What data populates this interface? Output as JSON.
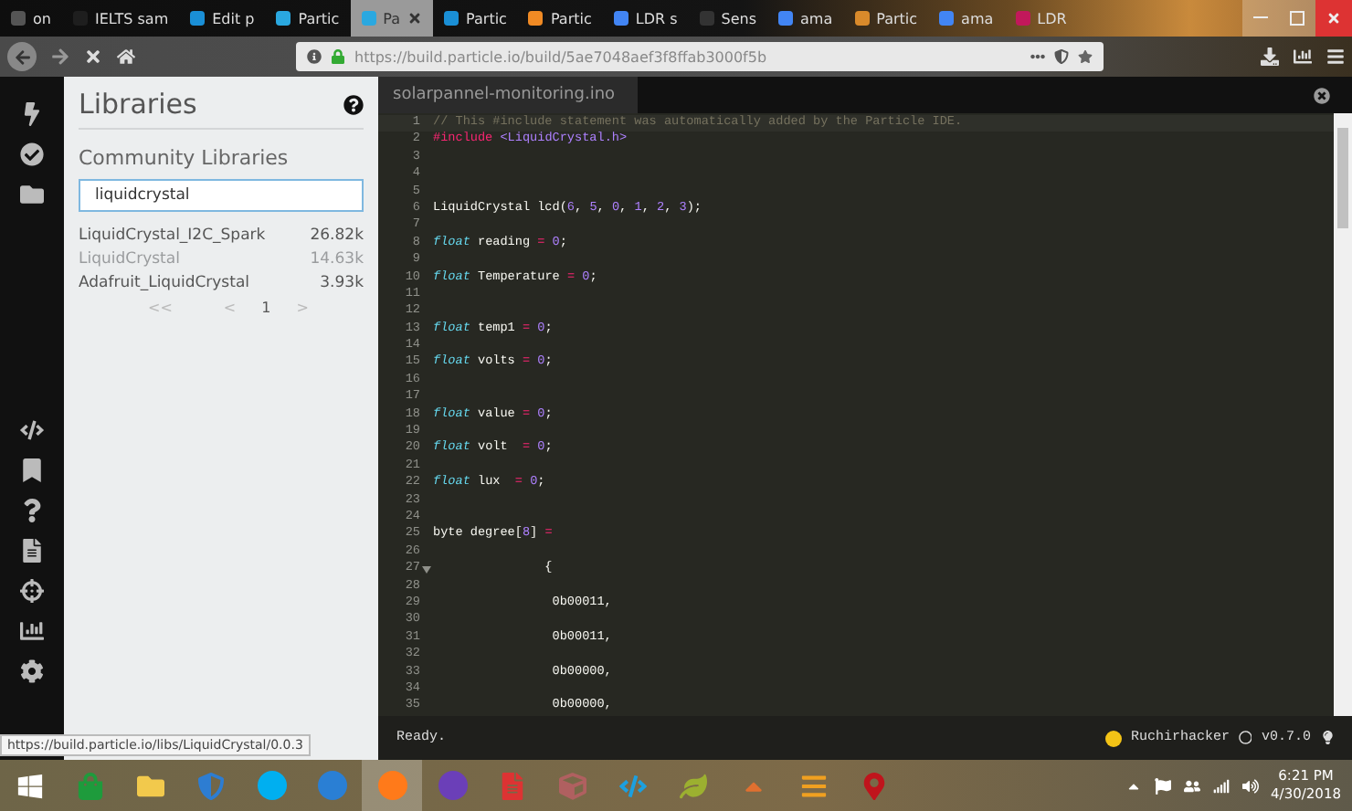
{
  "browser": {
    "tabs": [
      {
        "label": "on",
        "color": "#555555",
        "selected": false
      },
      {
        "label": "IELTS sam",
        "color": "#1e1e1e",
        "selected": false
      },
      {
        "label": "Edit p",
        "color": "#1a8fd6",
        "selected": false
      },
      {
        "label": "Partic",
        "color": "#2aa8e0",
        "selected": false
      },
      {
        "label": "Pa",
        "color": "#2aa8e0",
        "selected": true
      },
      {
        "label": "Partic",
        "color": "#1a8fd6",
        "selected": false
      },
      {
        "label": "Partic",
        "color": "#f08a24",
        "selected": false
      },
      {
        "label": "LDR s",
        "color": "#4285f4",
        "selected": false
      },
      {
        "label": "Sens",
        "color": "#333333",
        "selected": false
      },
      {
        "label": "ama",
        "color": "#4285f4",
        "selected": false
      },
      {
        "label": "Partic",
        "color": "#d98a2b",
        "selected": false
      },
      {
        "label": "ama",
        "color": "#4285f4",
        "selected": false
      },
      {
        "label": "LDR",
        "color": "#c2185b",
        "selected": false
      }
    ],
    "url": "https://build.particle.io/build/5ae7048aef3f8ffab3000f5b"
  },
  "libraries": {
    "title": "Libraries",
    "section": "Community Libraries",
    "search": {
      "value": "liquidcrystal"
    },
    "results": [
      {
        "name": "LiquidCrystal_I2C_Spark",
        "count": "26.82k",
        "disabled": false
      },
      {
        "name": "LiquidCrystal",
        "count": "14.63k",
        "disabled": true
      },
      {
        "name": "Adafruit_LiquidCrystal",
        "count": "3.93k",
        "disabled": false
      }
    ],
    "pager": {
      "first": "<<",
      "prev": "<",
      "page": "1",
      "next": ">"
    }
  },
  "editor": {
    "file_tab": "solarpannel-monitoring.ino",
    "lines": [
      {
        "n": "1",
        "fold": false,
        "tokens": [
          {
            "kind": "comment",
            "s": "// This #include statement was automatically added by the Particle IDE."
          }
        ]
      },
      {
        "n": "2",
        "fold": false,
        "tokens": [
          {
            "kind": "directive",
            "s": "#include "
          },
          {
            "kind": "path",
            "s": "<LiquidCrystal.h>"
          }
        ]
      },
      {
        "n": "3",
        "fold": false
      },
      {
        "n": "4",
        "fold": false
      },
      {
        "n": "5",
        "fold": false
      },
      {
        "n": "6",
        "fold": false,
        "tokens": [
          {
            "kind": "plain",
            "s": "LiquidCrystal lcd("
          },
          {
            "kind": "number",
            "s": "6"
          },
          {
            "kind": "plain",
            "s": ", "
          },
          {
            "kind": "number",
            "s": "5"
          },
          {
            "kind": "plain",
            "s": ", "
          },
          {
            "kind": "number",
            "s": "0"
          },
          {
            "kind": "plain",
            "s": ", "
          },
          {
            "kind": "number",
            "s": "1"
          },
          {
            "kind": "plain",
            "s": ", "
          },
          {
            "kind": "number",
            "s": "2"
          },
          {
            "kind": "plain",
            "s": ", "
          },
          {
            "kind": "number",
            "s": "3"
          },
          {
            "kind": "plain",
            "s": ");"
          }
        ]
      },
      {
        "n": "7",
        "fold": false
      },
      {
        "n": "8",
        "fold": false,
        "tokens": [
          {
            "kind": "keyword",
            "s": "float"
          },
          {
            "kind": "plain",
            "s": " reading "
          },
          {
            "kind": "operator",
            "s": "= "
          },
          {
            "kind": "number",
            "s": "0"
          },
          {
            "kind": "plain",
            "s": ";"
          }
        ]
      },
      {
        "n": "9",
        "fold": false
      },
      {
        "n": "10",
        "fold": false,
        "tokens": [
          {
            "kind": "keyword",
            "s": "float"
          },
          {
            "kind": "plain",
            "s": " Temperature "
          },
          {
            "kind": "operator",
            "s": "= "
          },
          {
            "kind": "number",
            "s": "0"
          },
          {
            "kind": "plain",
            "s": ";"
          }
        ]
      },
      {
        "n": "11",
        "fold": false
      },
      {
        "n": "12",
        "fold": false
      },
      {
        "n": "13",
        "fold": false,
        "tokens": [
          {
            "kind": "keyword",
            "s": "float"
          },
          {
            "kind": "plain",
            "s": " temp1 "
          },
          {
            "kind": "operator",
            "s": "= "
          },
          {
            "kind": "number",
            "s": "0"
          },
          {
            "kind": "plain",
            "s": ";"
          }
        ]
      },
      {
        "n": "14",
        "fold": false
      },
      {
        "n": "15",
        "fold": false,
        "tokens": [
          {
            "kind": "keyword",
            "s": "float"
          },
          {
            "kind": "plain",
            "s": " volts "
          },
          {
            "kind": "operator",
            "s": "= "
          },
          {
            "kind": "number",
            "s": "0"
          },
          {
            "kind": "plain",
            "s": ";"
          }
        ]
      },
      {
        "n": "16",
        "fold": false
      },
      {
        "n": "17",
        "fold": false
      },
      {
        "n": "18",
        "fold": false,
        "tokens": [
          {
            "kind": "keyword",
            "s": "float"
          },
          {
            "kind": "plain",
            "s": " value "
          },
          {
            "kind": "operator",
            "s": "= "
          },
          {
            "kind": "number",
            "s": "0"
          },
          {
            "kind": "plain",
            "s": ";"
          }
        ]
      },
      {
        "n": "19",
        "fold": false
      },
      {
        "n": "20",
        "fold": false,
        "tokens": [
          {
            "kind": "keyword",
            "s": "float"
          },
          {
            "kind": "plain",
            "s": " volt  "
          },
          {
            "kind": "operator",
            "s": "= "
          },
          {
            "kind": "number",
            "s": "0"
          },
          {
            "kind": "plain",
            "s": ";"
          }
        ]
      },
      {
        "n": "21",
        "fold": false
      },
      {
        "n": "22",
        "fold": false,
        "tokens": [
          {
            "kind": "keyword",
            "s": "float"
          },
          {
            "kind": "plain",
            "s": " lux  "
          },
          {
            "kind": "operator",
            "s": "= "
          },
          {
            "kind": "number",
            "s": "0"
          },
          {
            "kind": "plain",
            "s": ";"
          }
        ]
      },
      {
        "n": "23",
        "fold": false
      },
      {
        "n": "24",
        "fold": false
      },
      {
        "n": "25",
        "fold": false,
        "tokens": [
          {
            "kind": "plain",
            "s": "byte degree["
          },
          {
            "kind": "number",
            "s": "8"
          },
          {
            "kind": "plain",
            "s": "] "
          },
          {
            "kind": "operator",
            "s": "="
          }
        ]
      },
      {
        "n": "26",
        "fold": false
      },
      {
        "n": "27",
        "fold": true,
        "tokens": [
          {
            "kind": "plain",
            "s": "               {"
          }
        ]
      },
      {
        "n": "28",
        "fold": false
      },
      {
        "n": "29",
        "fold": false,
        "tokens": [
          {
            "kind": "plain",
            "s": "                0b00011,"
          }
        ]
      },
      {
        "n": "30",
        "fold": false
      },
      {
        "n": "31",
        "fold": false,
        "tokens": [
          {
            "kind": "plain",
            "s": "                0b00011,"
          }
        ]
      },
      {
        "n": "32",
        "fold": false
      },
      {
        "n": "33",
        "fold": false,
        "tokens": [
          {
            "kind": "plain",
            "s": "                0b00000,"
          }
        ]
      },
      {
        "n": "34",
        "fold": false
      },
      {
        "n": "35",
        "fold": false,
        "tokens": [
          {
            "kind": "plain",
            "s": "                0b00000,"
          }
        ]
      }
    ]
  },
  "status_bar": {
    "message": "Ready.",
    "user": "Ruchirhacker",
    "version": "v0.7.0"
  },
  "link_preview": "https://build.particle.io/libs/LiquidCrystal/0.0.3",
  "taskbar": {
    "time": "6:21 PM",
    "date": "4/30/2018"
  }
}
